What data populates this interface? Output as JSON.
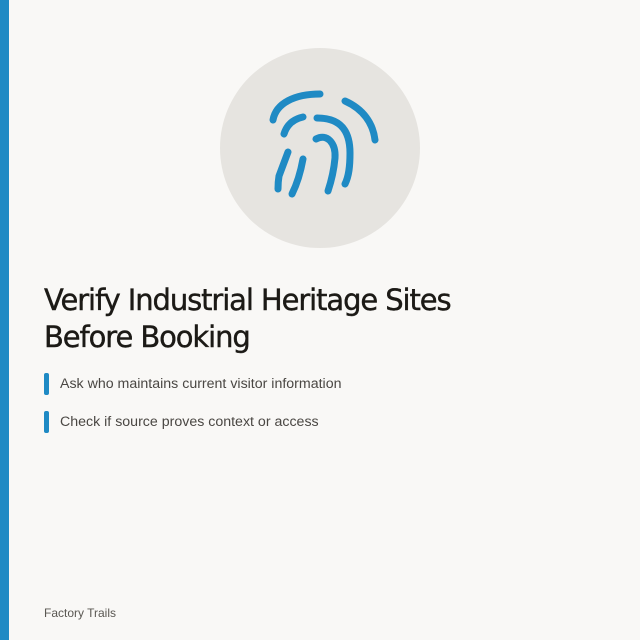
{
  "brand": {
    "accent_color": "#1f8ac4",
    "background_color": "#f9f8f6",
    "icon_circle_color": "#e6e4e0"
  },
  "hero": {
    "icon": "fingerprint-icon"
  },
  "headline": {
    "line1": "Verify Industrial Heritage Sites",
    "line2": "Before Booking"
  },
  "tips": [
    {
      "text": "Ask who maintains current visitor information"
    },
    {
      "text": "Check if source proves context or access"
    }
  ],
  "footer": {
    "brand_name": "Factory Trails"
  }
}
